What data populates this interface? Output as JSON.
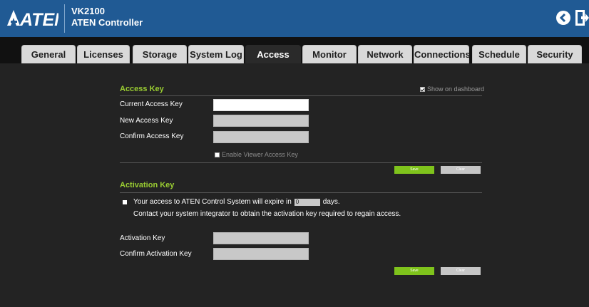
{
  "header": {
    "logo_text": "ATEN",
    "model": "VK2100",
    "subtitle": "ATEN Controller",
    "back_icon": "chevron-left-circle-icon",
    "logout_icon": "logout-icon"
  },
  "tabs": [
    {
      "label": "General",
      "active": false
    },
    {
      "label": "Licenses",
      "active": false
    },
    {
      "label": "Storage",
      "active": false
    },
    {
      "label": "System Log",
      "active": false
    },
    {
      "label": "Access",
      "active": true
    },
    {
      "label": "Monitor",
      "active": false
    },
    {
      "label": "Network",
      "active": false
    },
    {
      "label": "Connections",
      "active": false
    },
    {
      "label": "Schedule",
      "active": false
    },
    {
      "label": "Security",
      "active": false
    }
  ],
  "access_key": {
    "title": "Access Key",
    "show_on_dashboard": "Show on dashboard",
    "show_on_dashboard_checked": true,
    "current_label": "Current Access Key",
    "current_value": "",
    "new_label": "New Access Key",
    "new_value": "",
    "confirm_label": "Confirm Access Key",
    "confirm_value": "",
    "viewer_label": "Enable Viewer Access Key",
    "viewer_checked": false,
    "save_label": "Save",
    "clear_label": "Clear"
  },
  "activation": {
    "title": "Activation Key",
    "expire_prefix": "Your access to ATEN Control System will expire in",
    "days_value": "0",
    "expire_suffix": "days.",
    "contact": "Contact your system integrator to obtain the activation key required to regain access.",
    "key_label": "Activation Key",
    "key_value": "",
    "confirm_label": "Confirm Activation Key",
    "confirm_value": "",
    "save_label": "Save",
    "clear_label": "Clear"
  },
  "colors": {
    "header_bg": "#205a94",
    "accent_green": "#9acd32",
    "save_green": "#7fc31c"
  }
}
